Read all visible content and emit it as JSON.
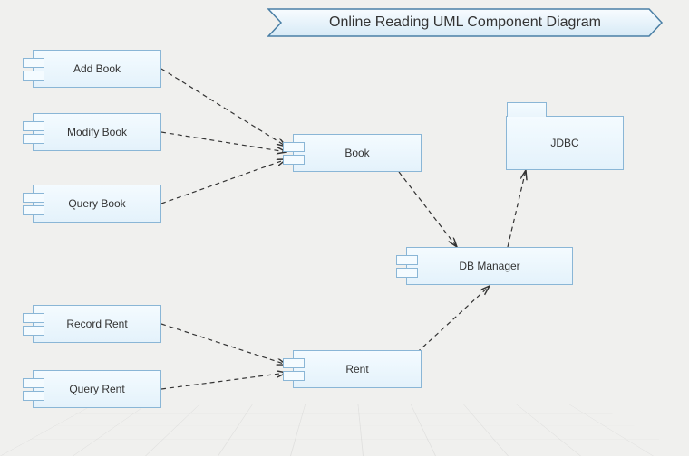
{
  "title": "Online Reading UML Component Diagram",
  "components": {
    "add_book": "Add Book",
    "modify_book": "Modify Book",
    "query_book": "Query Book",
    "record_rent": "Record Rent",
    "query_rent": "Query Rent",
    "book": "Book",
    "rent": "Rent",
    "db_manager": "DB Manager",
    "jdbc": "JDBC"
  },
  "edges": [
    {
      "from": "add_book",
      "to": "book"
    },
    {
      "from": "modify_book",
      "to": "book"
    },
    {
      "from": "query_book",
      "to": "book"
    },
    {
      "from": "record_rent",
      "to": "rent"
    },
    {
      "from": "query_rent",
      "to": "rent"
    },
    {
      "from": "book",
      "to": "db_manager"
    },
    {
      "from": "rent",
      "to": "db_manager"
    },
    {
      "from": "db_manager",
      "to": "jdbc"
    }
  ]
}
